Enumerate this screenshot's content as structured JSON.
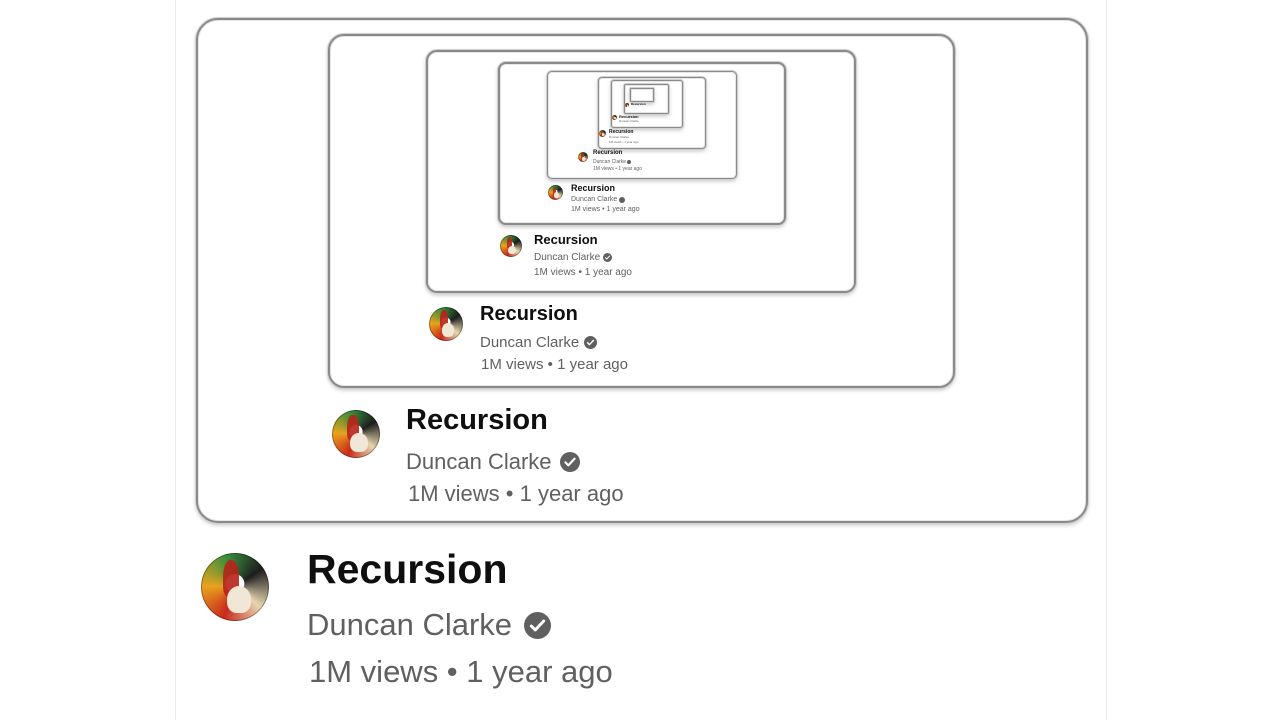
{
  "video": {
    "title": "Recursion",
    "channel": "Duncan Clarke",
    "stats": "1M views • 1 year ago"
  },
  "icons": {
    "verified": "verified-check-icon",
    "avatar": "channel-avatar"
  },
  "colors": {
    "title": "#0f0f0f",
    "secondary": "#606060",
    "background": "#ffffff",
    "frame_border": "#8a8a8a"
  }
}
